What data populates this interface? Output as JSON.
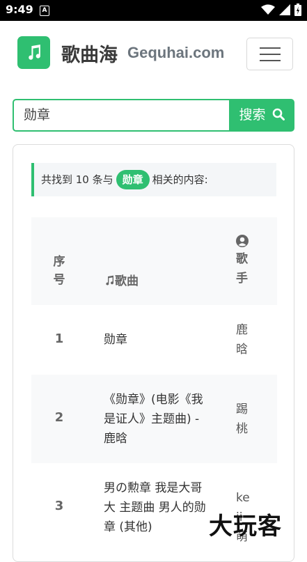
{
  "status_bar": {
    "time": "9:49",
    "notif_letter": "A"
  },
  "header": {
    "brand_cn": "歌曲海",
    "brand_en": "Gequhai.com"
  },
  "search": {
    "value": "勋章",
    "button_label": "搜索"
  },
  "result": {
    "prefix": "共找到 10 条与",
    "keyword": "勋章",
    "suffix": "相关的内容:"
  },
  "table": {
    "headers": {
      "index": "序号",
      "song": "歌曲",
      "singer": "歌手"
    },
    "rows": [
      {
        "index": "1",
        "song": "勋章",
        "singer": "鹿晗"
      },
      {
        "index": "2",
        "song": "《勋章》(电影《我是证人》主题曲) - 鹿晗",
        "singer": "踢桃"
      },
      {
        "index": "3",
        "song": "男の勲章 我是大哥大 主题曲 男人的勋章 (其他)",
        "singer": "keii萌"
      }
    ]
  },
  "watermark": "大玩客",
  "colors": {
    "accent": "#2fbf71"
  }
}
